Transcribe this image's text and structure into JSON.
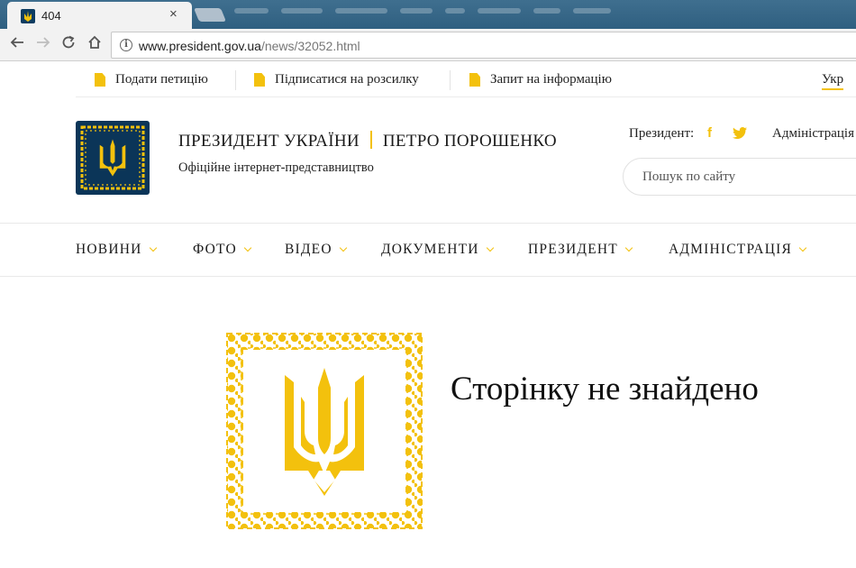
{
  "browser": {
    "tab": {
      "title": "404",
      "close_icon": "×"
    },
    "address": {
      "host": "www.president.gov.ua",
      "path": "/news/32052.html"
    }
  },
  "utility_bar": {
    "items": [
      {
        "label": "Подати петицію",
        "icon": "document-icon"
      },
      {
        "label": "Підписатися на розсилку",
        "icon": "document-icon"
      },
      {
        "label": "Запит на інформацію",
        "icon": "document-icon"
      }
    ],
    "language": "Укр"
  },
  "header": {
    "title_left": "ПРЕЗИДЕНТ УКРАЇНИ",
    "title_right": "ПЕТРО ПОРОШЕНКО",
    "subtitle": "Офіційне інтернет-представництво",
    "president_label": "Президент:",
    "facebook_glyph": "f",
    "admin_link": "Адміністрація",
    "search_placeholder": "Пошук по сайту"
  },
  "nav": {
    "items": [
      "НОВИНИ",
      "ФОТО",
      "ВІДЕО",
      "ДОКУМЕНТИ",
      "ПРЕЗИДЕНТ",
      "АДМІНІСТРАЦІЯ"
    ]
  },
  "error": {
    "message": "Сторінку не знайдено"
  },
  "colors": {
    "accent": "#f3c10d",
    "navy": "#0b3558",
    "text": "#1a1a1a"
  }
}
